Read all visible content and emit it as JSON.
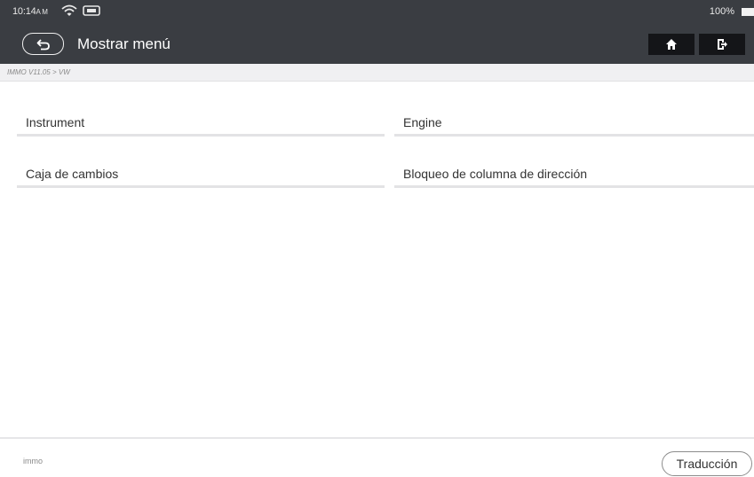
{
  "status_bar": {
    "time": "10:14",
    "ampm": "A M",
    "battery": "100%"
  },
  "header": {
    "title": "Mostrar menú"
  },
  "breadcrumb": "IMMO V11.05 > VW",
  "menu": {
    "items": [
      {
        "label": "Instrument"
      },
      {
        "label": "Engine"
      },
      {
        "label": "Caja de cambios"
      },
      {
        "label": "Bloqueo de columna de dirección"
      }
    ]
  },
  "footer": {
    "label": "immo",
    "translate_button": "Traducción"
  },
  "icons": {
    "back": "back-arrow-icon",
    "home": "home-icon",
    "exit": "exit-icon",
    "wifi": "wifi-icon",
    "device": "vci-device-icon",
    "battery": "battery-icon"
  },
  "colors": {
    "header_bg": "#3a3d42",
    "header_button_bg": "#141518",
    "page_bg": "#ffffff",
    "breadcrumb_bg": "#f0f0f2",
    "text": "#333333"
  }
}
